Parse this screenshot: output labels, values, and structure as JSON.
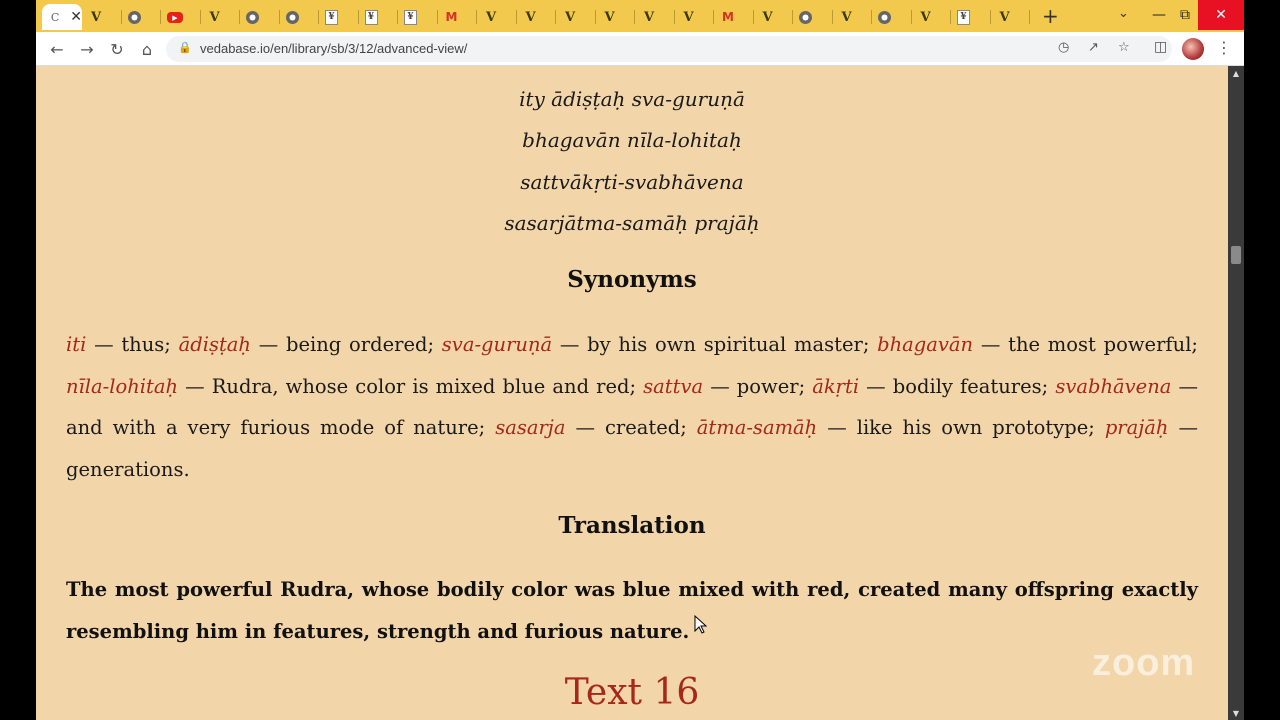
{
  "browser": {
    "tabs": [
      {
        "icon": "generic-icon",
        "label": "C",
        "active": true
      },
      {
        "icon": "vedabase-icon",
        "label": "V"
      },
      {
        "icon": "chrome-icon",
        "label": ""
      },
      {
        "icon": "youtube-icon",
        "label": ""
      },
      {
        "icon": "vedabase-icon",
        "label": "V"
      },
      {
        "icon": "chrome-icon",
        "label": ""
      },
      {
        "icon": "chrome-icon",
        "label": ""
      },
      {
        "icon": "doc-icon",
        "label": ""
      },
      {
        "icon": "doc-icon",
        "label": ""
      },
      {
        "icon": "doc-icon",
        "label": ""
      },
      {
        "icon": "gmail-icon",
        "label": "M"
      },
      {
        "icon": "vedabase-icon",
        "label": "V"
      },
      {
        "icon": "vedabase-icon",
        "label": "V"
      },
      {
        "icon": "vedabase-icon",
        "label": "V"
      },
      {
        "icon": "vedabase-icon",
        "label": "V"
      },
      {
        "icon": "vedabase-icon",
        "label": "V"
      },
      {
        "icon": "vedabase-icon",
        "label": "V"
      },
      {
        "icon": "gmail-icon",
        "label": "M"
      },
      {
        "icon": "vedabase-icon",
        "label": "V"
      },
      {
        "icon": "chrome-icon",
        "label": ""
      },
      {
        "icon": "vedabase-icon",
        "label": "V"
      },
      {
        "icon": "chrome-icon",
        "label": ""
      },
      {
        "icon": "vedabase-icon",
        "label": "V"
      },
      {
        "icon": "doc-icon",
        "label": ""
      },
      {
        "icon": "vedabase-icon",
        "label": "V"
      }
    ],
    "new_tab": "+",
    "url": "vedabase.io/en/library/sb/3/12/advanced-view/",
    "colors": {
      "tabstrip": "#f2c94c",
      "page_bg": "#f2d5a9",
      "accent_red": "#a5281b"
    }
  },
  "verse": {
    "lines": [
      "ity ādiṣṭaḥ sva-guruṇā",
      "bhagavān nīla-lohitaḥ",
      "sattvākṛti-svabhāvena",
      "sasarjātma-samāḥ prajāḥ"
    ]
  },
  "synonyms": {
    "heading": "Synonyms",
    "items": [
      {
        "word": "iti",
        "meaning": " — thus; "
      },
      {
        "word": "ādiṣṭaḥ",
        "meaning": " — being ordered; "
      },
      {
        "word": "sva-guruṇā",
        "meaning": " — by his own spiritual master; "
      },
      {
        "word": "bhagavān",
        "meaning": " — the most powerful; "
      },
      {
        "word": "nīla-lohitaḥ",
        "meaning": " — Rudra, whose color is mixed blue and red; "
      },
      {
        "word": "sattva",
        "meaning": " — power; "
      },
      {
        "word": "ākṛti",
        "meaning": " — bodily features; "
      },
      {
        "word": "svabhāvena",
        "meaning": " — and with a very furious mode of nature; "
      },
      {
        "word": "sasarja",
        "meaning": " — created; "
      },
      {
        "word": "ātma-samāḥ",
        "meaning": " — like his own prototype; "
      },
      {
        "word": "prajāḥ",
        "meaning": " — generations."
      }
    ]
  },
  "translation": {
    "heading": "Translation",
    "text": "The most powerful Rudra, whose bodily color was blue mixed with red, created many offspring exactly resembling him in features, strength and furious nature."
  },
  "next_text": {
    "label": "Text 16"
  },
  "watermark": "zoom"
}
